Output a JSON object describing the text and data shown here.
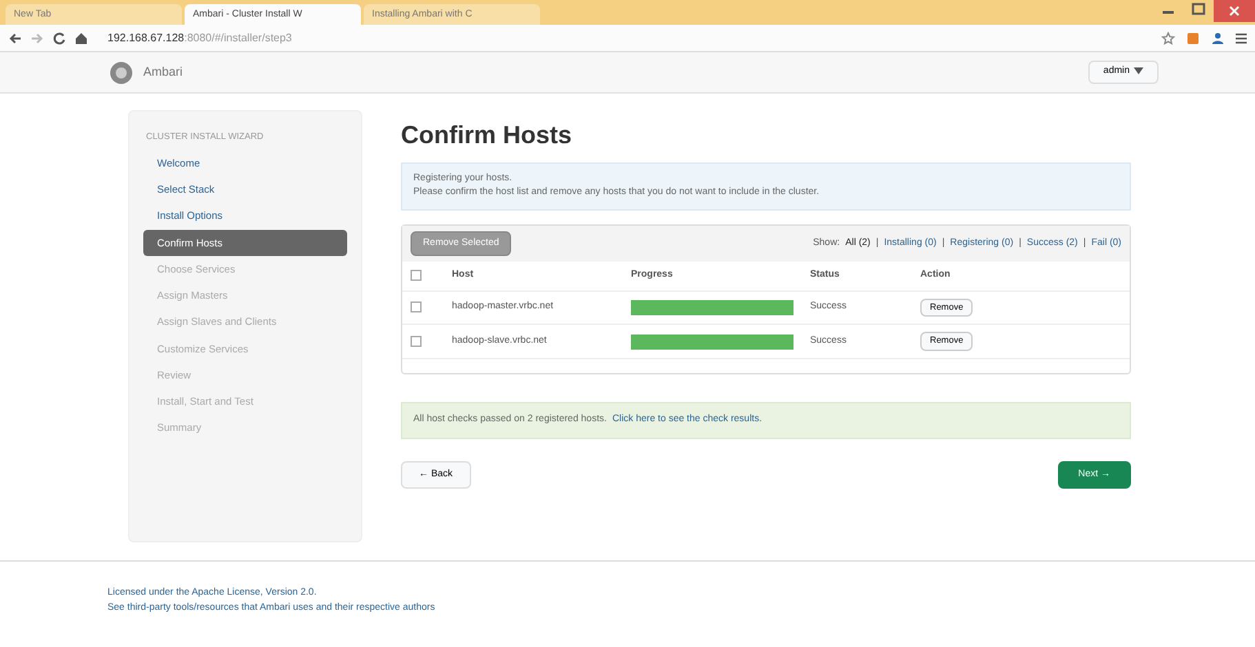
{
  "browser": {
    "tabs": [
      {
        "label": "New Tab",
        "selected": false
      },
      {
        "label": "Ambari - Cluster Install W",
        "selected": true
      },
      {
        "label": "Installing Ambari with C",
        "selected": false
      }
    ],
    "url_host": "192.168.67.128",
    "url_path": ":8080/#/installer/step3"
  },
  "navbar": {
    "brand": "Ambari",
    "user_menu": "admin"
  },
  "wizard": {
    "title": "CLUSTER INSTALL WIZARD",
    "steps": [
      {
        "label": "Welcome",
        "selected": false,
        "disabled": false
      },
      {
        "label": "Select Stack",
        "selected": false,
        "disabled": false
      },
      {
        "label": "Install Options",
        "selected": false,
        "disabled": false
      },
      {
        "label": "Confirm Hosts",
        "selected": true,
        "disabled": false
      },
      {
        "label": "Choose Services",
        "selected": false,
        "disabled": true
      },
      {
        "label": "Assign Masters",
        "selected": false,
        "disabled": true
      },
      {
        "label": "Assign Slaves and Clients",
        "selected": false,
        "disabled": true
      },
      {
        "label": "Customize Services",
        "selected": false,
        "disabled": true
      },
      {
        "label": "Review",
        "selected": false,
        "disabled": true
      },
      {
        "label": "Install, Start and Test",
        "selected": false,
        "disabled": true
      },
      {
        "label": "Summary",
        "selected": false,
        "disabled": true
      }
    ]
  },
  "page": {
    "title": "Confirm Hosts",
    "info": [
      "Registering your hosts.",
      "Please confirm the host list and remove any hosts that you do not want to include in the cluster."
    ],
    "remove_selected": "Remove Selected",
    "filter_label": "Show:",
    "filter_separator": "|",
    "select_all_checked": false,
    "filters": [
      {
        "label": "All (2)",
        "selected": true
      },
      {
        "label": "Installing (0)",
        "selected": false
      },
      {
        "label": "Registering (0)",
        "selected": false
      },
      {
        "label": "Success (2)",
        "selected": false
      },
      {
        "label": "Fail (0)",
        "selected": false
      }
    ],
    "columns": [
      "Host",
      "Progress",
      "Status",
      "Action"
    ],
    "hosts": [
      {
        "host": "hadoop-master.vrbc.net",
        "checked": false,
        "level": 1,
        "status": "Success",
        "action": "Remove"
      },
      {
        "host": "hadoop-slave.vrbc.net",
        "checked": false,
        "level": 1,
        "status": "Success",
        "action": "Remove"
      }
    ],
    "checks_text": "All host checks passed on 2 registered hosts.",
    "checks_link": "Click here to see the check results.",
    "back": "← Back",
    "next": "Next →"
  },
  "footer": {
    "license": "Licensed under the Apache License, Version 2.0.",
    "third_party": "See third-party tools/resources that Ambari uses and their respective authors"
  }
}
